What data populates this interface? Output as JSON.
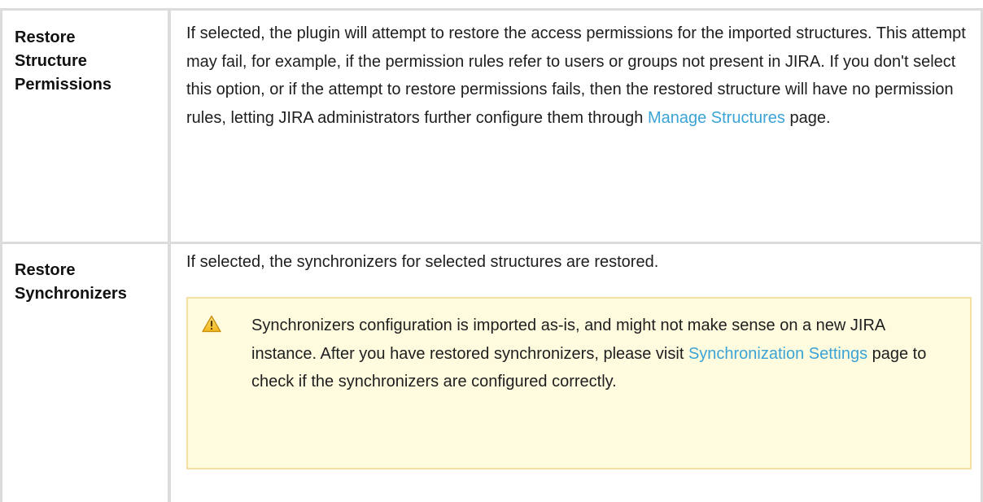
{
  "rows": [
    {
      "label_lines": [
        "Restore",
        "Structure",
        "Permissions"
      ],
      "text": {
        "before_link": "If selected, the plugin will attempt to restore the access permissions for the imported structures. This attempt may fail, for example, if the permission rules refer to users or groups not present in JIRA. If you don't select this option, or if the attempt to restore permissions fails, then the restored structure will have no permission rules, letting JIRA administrators further configure them through ",
        "link": "Manage Structures",
        "after_link": " page."
      }
    },
    {
      "label_lines": [
        "Restore",
        "Synchronizers"
      ],
      "text": "If selected, the synchronizers for selected structures are restored.",
      "warning": {
        "icon": "warning-icon",
        "before_link": "Synchronizers configuration is imported as-is, and might not make sense on a new JIRA instance. After you have restored synchronizers, please visit ",
        "link": "Synchronization Settings",
        "after_link": " page to check if the synchronizers are configured correctly."
      }
    }
  ],
  "colors": {
    "border": "#dcdcdc",
    "link": "#3ba3d6",
    "warning_bg": "#fefbdf",
    "warning_border": "#f3e0a2"
  }
}
